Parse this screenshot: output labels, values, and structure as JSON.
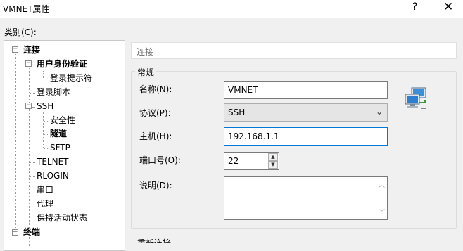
{
  "window": {
    "title": "VMNET属性",
    "help": "?",
    "close": "✕"
  },
  "category_label": "类别(C):",
  "tree": {
    "connection": "连接",
    "user_auth": "用户身份验证",
    "login_prompt": "登录提示符",
    "login_script": "登录脚本",
    "ssh": "SSH",
    "security": "安全性",
    "tunnel": "隧道",
    "sftp": "SFTP",
    "telnet": "TELNET",
    "rlogin": "RLOGIN",
    "serial": "串口",
    "proxy": "代理",
    "keepalive": "保持活动状态",
    "terminal": "终端"
  },
  "header_text": "连接",
  "group": {
    "title": "常规"
  },
  "form": {
    "name_label": "名称(N):",
    "name_value": "VMNET",
    "protocol_label": "协议(P):",
    "protocol_value": "SSH",
    "host_label": "主机(H):",
    "host_value": "192.168.1.1",
    "port_label": "端口号(O):",
    "port_value": "22",
    "desc_label": "说明(D):",
    "desc_value": ""
  },
  "reconnect_title": "重新连接",
  "icons": {
    "network": "network-computers-icon",
    "dropdown": "chevron-down-icon"
  }
}
